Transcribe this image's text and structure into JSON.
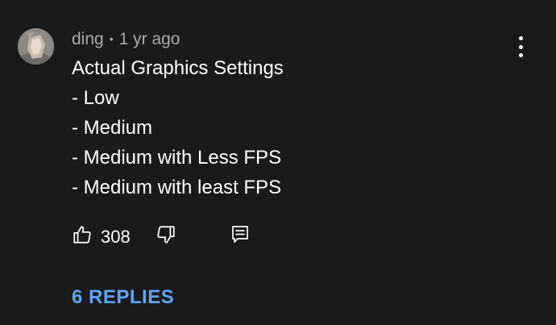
{
  "comment": {
    "author": "ding",
    "separator": "•",
    "timestamp": "1 yr ago",
    "lines": [
      "Actual Graphics Settings",
      "- Low",
      "- Medium",
      "- Medium with Less FPS",
      "- Medium with least FPS"
    ],
    "like_count": "308",
    "replies_label": "6 REPLIES"
  },
  "icons": {
    "more": "more-vertical-icon",
    "like": "thumbs-up-icon",
    "dislike": "thumbs-down-icon",
    "reply": "reply-comment-icon"
  },
  "colors": {
    "background": "#1a1a1a",
    "text": "#ffffff",
    "meta_text": "#aaaaaa",
    "link": "#5aa6f6"
  }
}
